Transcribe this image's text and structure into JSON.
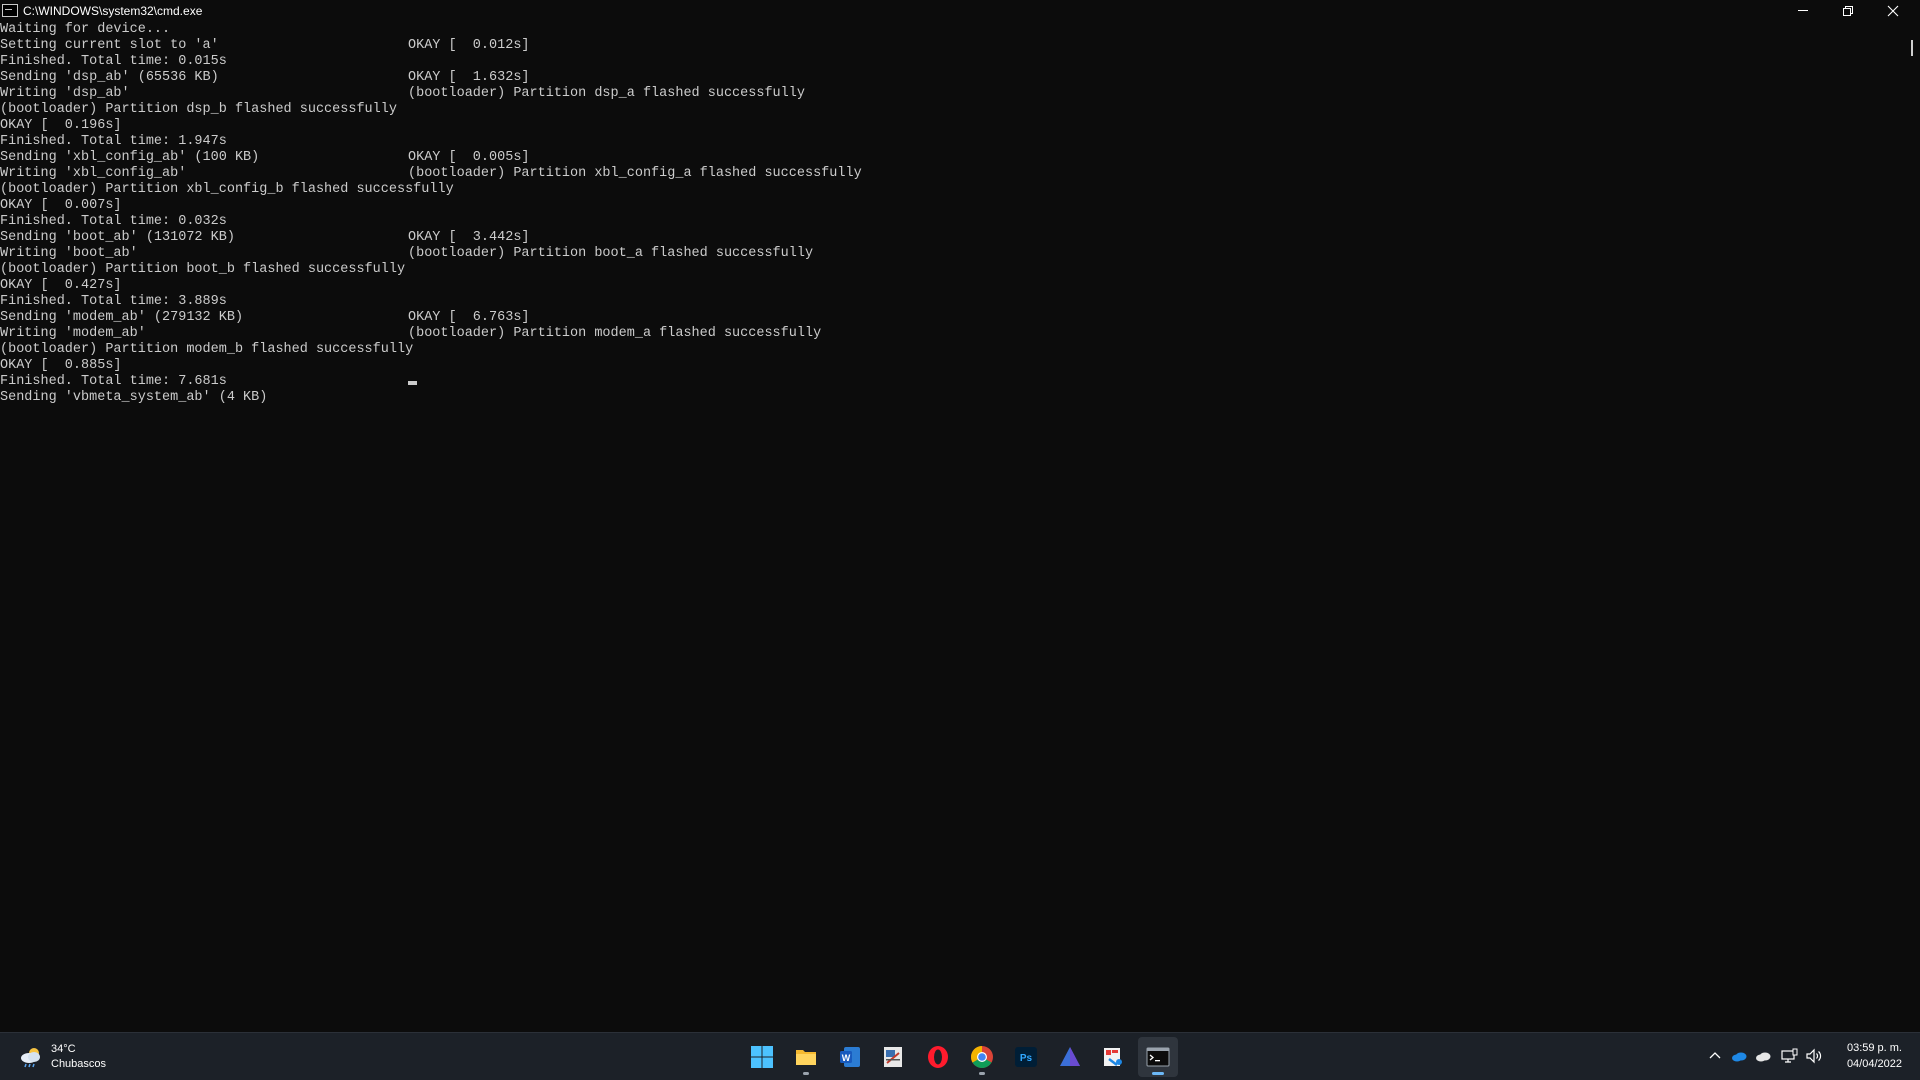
{
  "window": {
    "title": "C:\\WINDOWS\\system32\\cmd.exe"
  },
  "console": {
    "lines": [
      {
        "text": "Waiting for device...",
        "right": ""
      },
      {
        "text": "Setting current slot to 'a'",
        "right": "OKAY [  0.012s]"
      },
      {
        "text": "Finished. Total time: 0.015s",
        "right": ""
      },
      {
        "text": "Sending 'dsp_ab' (65536 KB)",
        "right": "OKAY [  1.632s]"
      },
      {
        "text": "Writing 'dsp_ab'",
        "right": "(bootloader) Partition dsp_a flashed successfully"
      },
      {
        "text": "(bootloader) Partition dsp_b flashed successfully",
        "right": ""
      },
      {
        "text": "OKAY [  0.196s]",
        "right": ""
      },
      {
        "text": "Finished. Total time: 1.947s",
        "right": ""
      },
      {
        "text": "Sending 'xbl_config_ab' (100 KB)",
        "right": "OKAY [  0.005s]"
      },
      {
        "text": "Writing 'xbl_config_ab'",
        "right": "(bootloader) Partition xbl_config_a flashed successfully"
      },
      {
        "text": "(bootloader) Partition xbl_config_b flashed successfully",
        "right": ""
      },
      {
        "text": "OKAY [  0.007s]",
        "right": ""
      },
      {
        "text": "Finished. Total time: 0.032s",
        "right": ""
      },
      {
        "text": "Sending 'boot_ab' (131072 KB)",
        "right": "OKAY [  3.442s]"
      },
      {
        "text": "Writing 'boot_ab'",
        "right": "(bootloader) Partition boot_a flashed successfully"
      },
      {
        "text": "(bootloader) Partition boot_b flashed successfully",
        "right": ""
      },
      {
        "text": "OKAY [  0.427s]",
        "right": ""
      },
      {
        "text": "Finished. Total time: 3.889s",
        "right": ""
      },
      {
        "text": "Sending 'modem_ab' (279132 KB)",
        "right": "OKAY [  6.763s]"
      },
      {
        "text": "Writing 'modem_ab'",
        "right": "(bootloader) Partition modem_a flashed successfully"
      },
      {
        "text": "(bootloader) Partition modem_b flashed successfully",
        "right": ""
      },
      {
        "text": "OKAY [  0.885s]",
        "right": ""
      },
      {
        "text": "Finished. Total time: 7.681s",
        "right": ""
      },
      {
        "text": "Sending 'vbmeta_system_ab' (4 KB)",
        "right": ""
      }
    ],
    "text_color": "#cccccc",
    "background": "#0c0c0c"
  },
  "taskbar": {
    "weather": {
      "temperature": "34°C",
      "condition": "Chubascos",
      "icon": "cloud-rain-icon"
    },
    "apps": [
      {
        "id": "start",
        "icon": "windows-start-icon",
        "running": false,
        "active": false
      },
      {
        "id": "file-explorer",
        "icon": "folder-icon",
        "running": true,
        "active": false
      },
      {
        "id": "word",
        "icon": "word-icon",
        "running": false,
        "active": false
      },
      {
        "id": "snipping",
        "icon": "snip-icon",
        "running": false,
        "active": false
      },
      {
        "id": "opera",
        "icon": "opera-icon",
        "running": false,
        "active": false
      },
      {
        "id": "chrome",
        "icon": "chrome-icon",
        "running": true,
        "active": false
      },
      {
        "id": "photoshop",
        "icon": "photoshop-icon",
        "running": false,
        "active": false
      },
      {
        "id": "triangle-app",
        "icon": "triangle-icon",
        "running": false,
        "active": false
      },
      {
        "id": "sketch-app",
        "icon": "paint-icon",
        "running": false,
        "active": false
      },
      {
        "id": "terminal",
        "icon": "terminal-icon",
        "running": true,
        "active": true
      }
    ],
    "photoshop_label": "Ps",
    "word_label": "W",
    "tray": {
      "icons": [
        "chevron-up-icon",
        "onedrive-icon",
        "cloud-icon",
        "network-icon",
        "volume-icon"
      ]
    },
    "clock": {
      "time": "03:59 p. m.",
      "date": "04/04/2022"
    }
  },
  "colors": {
    "taskbar_bg": "#1c2128",
    "accent": "#6cb8f6"
  }
}
